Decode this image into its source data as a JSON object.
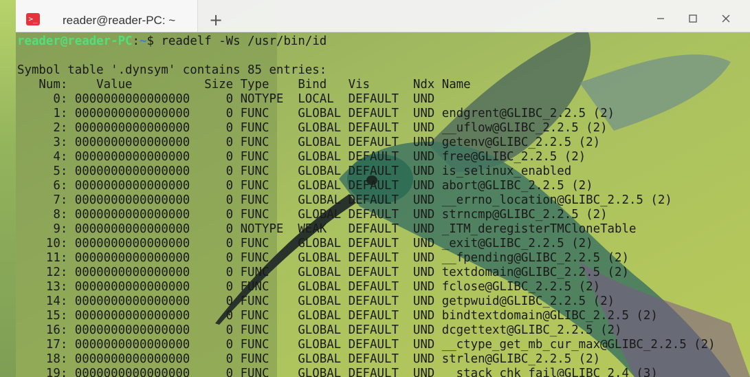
{
  "tab": {
    "title": "reader@reader-PC: ~",
    "icon": "terminal-icon",
    "icon_color": "#e5323c"
  },
  "new_tab_label": "+",
  "window_buttons": {
    "minimize": "minimize-icon",
    "maximize": "maximize-icon",
    "close": "close-icon"
  },
  "prompt": {
    "user_host": "reader@reader-PC",
    "sep": ":",
    "path": "~",
    "symbol": "$",
    "command": " readelf -Ws /usr/bin/id"
  },
  "output": {
    "header": "Symbol table '.dynsym' contains 85 entries:",
    "columns": "   Num:    Value          Size Type    Bind   Vis      Ndx Name",
    "rows": [
      "     0: 0000000000000000     0 NOTYPE  LOCAL  DEFAULT  UND",
      "     1: 0000000000000000     0 FUNC    GLOBAL DEFAULT  UND endgrent@GLIBC_2.2.5 (2)",
      "     2: 0000000000000000     0 FUNC    GLOBAL DEFAULT  UND __uflow@GLIBC_2.2.5 (2)",
      "     3: 0000000000000000     0 FUNC    GLOBAL DEFAULT  UND getenv@GLIBC_2.2.5 (2)",
      "     4: 0000000000000000     0 FUNC    GLOBAL DEFAULT  UND free@GLIBC_2.2.5 (2)",
      "     5: 0000000000000000     0 FUNC    GLOBAL DEFAULT  UND is_selinux_enabled",
      "     6: 0000000000000000     0 FUNC    GLOBAL DEFAULT  UND abort@GLIBC_2.2.5 (2)",
      "     7: 0000000000000000     0 FUNC    GLOBAL DEFAULT  UND __errno_location@GLIBC_2.2.5 (2)",
      "     8: 0000000000000000     0 FUNC    GLOBAL DEFAULT  UND strncmp@GLIBC_2.2.5 (2)",
      "     9: 0000000000000000     0 NOTYPE  WEAK   DEFAULT  UND _ITM_deregisterTMCloneTable",
      "    10: 0000000000000000     0 FUNC    GLOBAL DEFAULT  UND _exit@GLIBC_2.2.5 (2)",
      "    11: 0000000000000000     0 FUNC    GLOBAL DEFAULT  UND __fpending@GLIBC_2.2.5 (2)",
      "    12: 0000000000000000     0 FUNC    GLOBAL DEFAULT  UND textdomain@GLIBC_2.2.5 (2)",
      "    13: 0000000000000000     0 FUNC    GLOBAL DEFAULT  UND fclose@GLIBC_2.2.5 (2)",
      "    14: 0000000000000000     0 FUNC    GLOBAL DEFAULT  UND getpwuid@GLIBC_2.2.5 (2)",
      "    15: 0000000000000000     0 FUNC    GLOBAL DEFAULT  UND bindtextdomain@GLIBC_2.2.5 (2)",
      "    16: 0000000000000000     0 FUNC    GLOBAL DEFAULT  UND dcgettext@GLIBC_2.2.5 (2)",
      "    17: 0000000000000000     0 FUNC    GLOBAL DEFAULT  UND __ctype_get_mb_cur_max@GLIBC_2.2.5 (2)",
      "    18: 0000000000000000     0 FUNC    GLOBAL DEFAULT  UND strlen@GLIBC_2.2.5 (2)",
      "    19: 0000000000000000     0 FUNC    GLOBAL DEFAULT  UND __stack_chk_fail@GLIBC_2.4 (3)"
    ]
  }
}
